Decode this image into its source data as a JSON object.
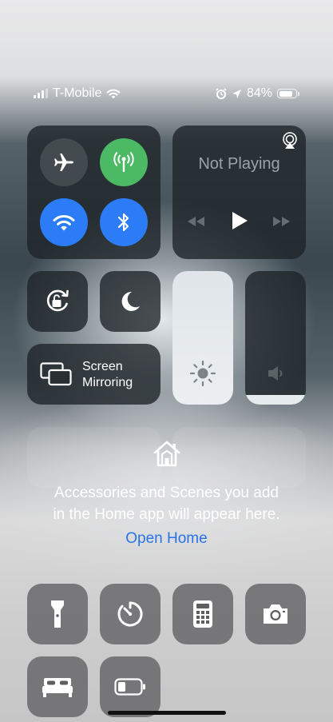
{
  "status_bar": {
    "carrier": "T-Mobile",
    "battery_percent": "84%",
    "battery_level": 0.84,
    "signal_bars_filled": 3,
    "signal_bars_total": 4
  },
  "connectivity": {
    "airplane_mode": false,
    "cellular_data": true,
    "wifi": true,
    "bluetooth": true
  },
  "media": {
    "title": "Not Playing"
  },
  "controls": {
    "orientation_lock": false,
    "do_not_disturb": false,
    "screen_mirroring_label_line1": "Screen",
    "screen_mirroring_label_line2": "Mirroring"
  },
  "sliders": {
    "brightness_level": 1.0,
    "volume_level": 0.07
  },
  "home": {
    "message_line1": "Accessories and Scenes you add",
    "message_line2": "in the Home app will appear here.",
    "link": "Open Home"
  },
  "utilities": {
    "icons": [
      "flashlight-icon",
      "timer-icon",
      "calculator-icon",
      "camera-icon",
      "bed-icon",
      "low-power-battery-icon"
    ]
  },
  "colors": {
    "cellular_green": "#4cb964",
    "accent_blue": "#2b7cf6",
    "link_blue": "#2a73e8"
  }
}
